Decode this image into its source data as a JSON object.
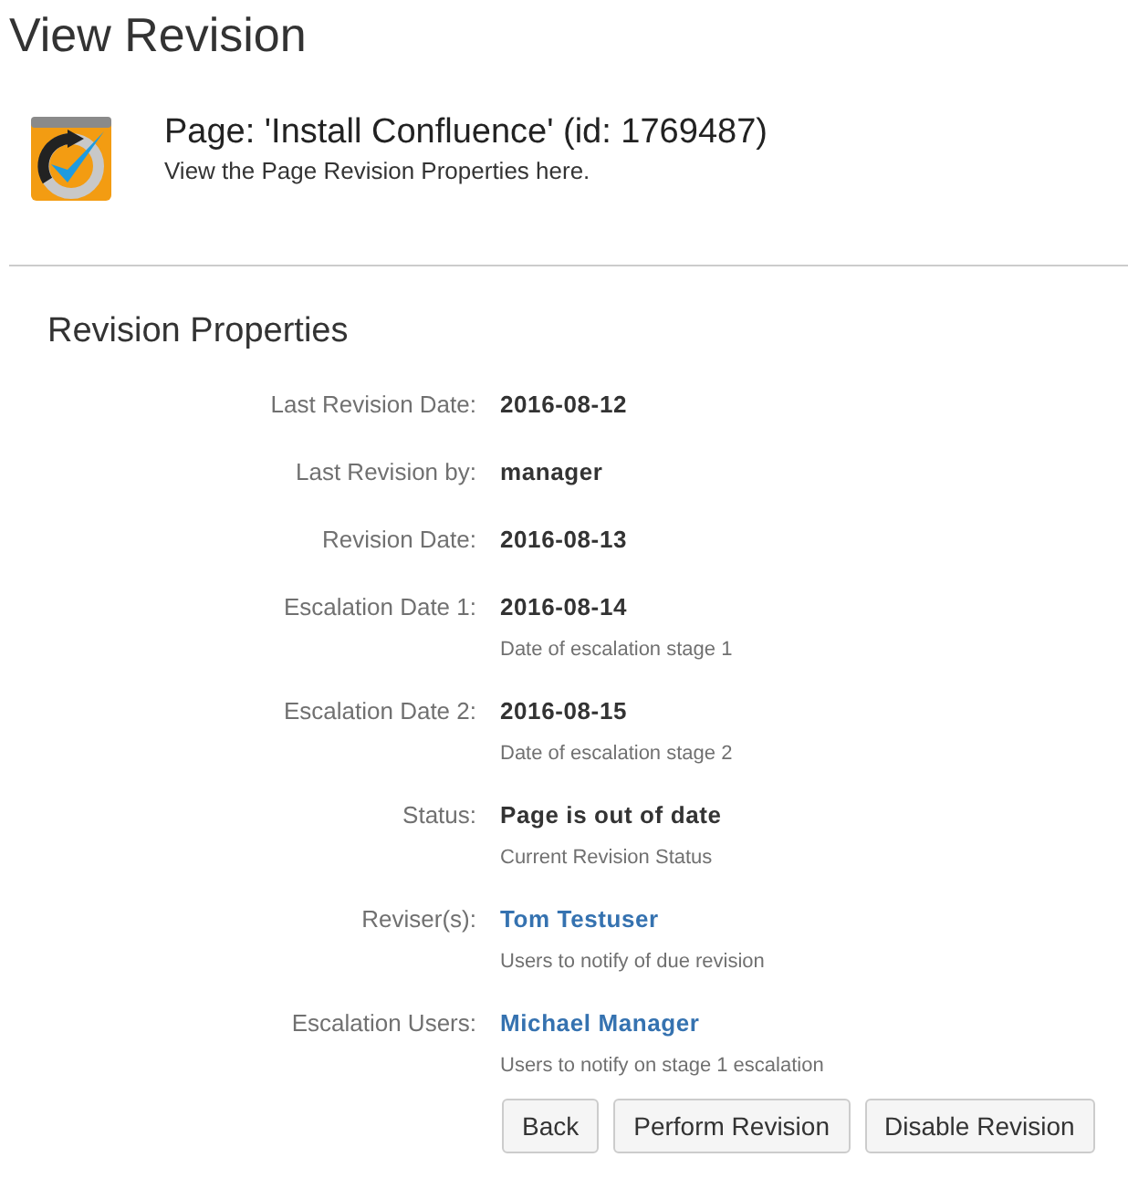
{
  "page_title": "View Revision",
  "header": {
    "title": "Page: 'Install Confluence' (id: 1769487)",
    "subtitle": "View the Page Revision Properties here."
  },
  "section_title": "Revision Properties",
  "fields": [
    {
      "label": "Last Revision Date:",
      "value": "2016-08-12",
      "kind": "text"
    },
    {
      "label": "Last Revision by:",
      "value": "manager",
      "kind": "text"
    },
    {
      "label": "Revision Date:",
      "value": "2016-08-13",
      "kind": "text"
    },
    {
      "label": "Escalation Date 1:",
      "value": "2016-08-14",
      "kind": "text",
      "description": "Date of escalation stage 1"
    },
    {
      "label": "Escalation Date 2:",
      "value": "2016-08-15",
      "kind": "text",
      "description": "Date of escalation stage 2"
    },
    {
      "label": "Status:",
      "value": "Page is out of date",
      "kind": "text",
      "description": "Current Revision Status"
    },
    {
      "label": "Reviser(s):",
      "value": "Tom Testuser",
      "kind": "link",
      "description": "Users to notify of due revision"
    },
    {
      "label": "Escalation Users:",
      "value": "Michael Manager",
      "kind": "link",
      "description": "Users to notify on stage 1 escalation"
    }
  ],
  "buttons": [
    "Back",
    "Perform Revision",
    "Disable Revision"
  ]
}
